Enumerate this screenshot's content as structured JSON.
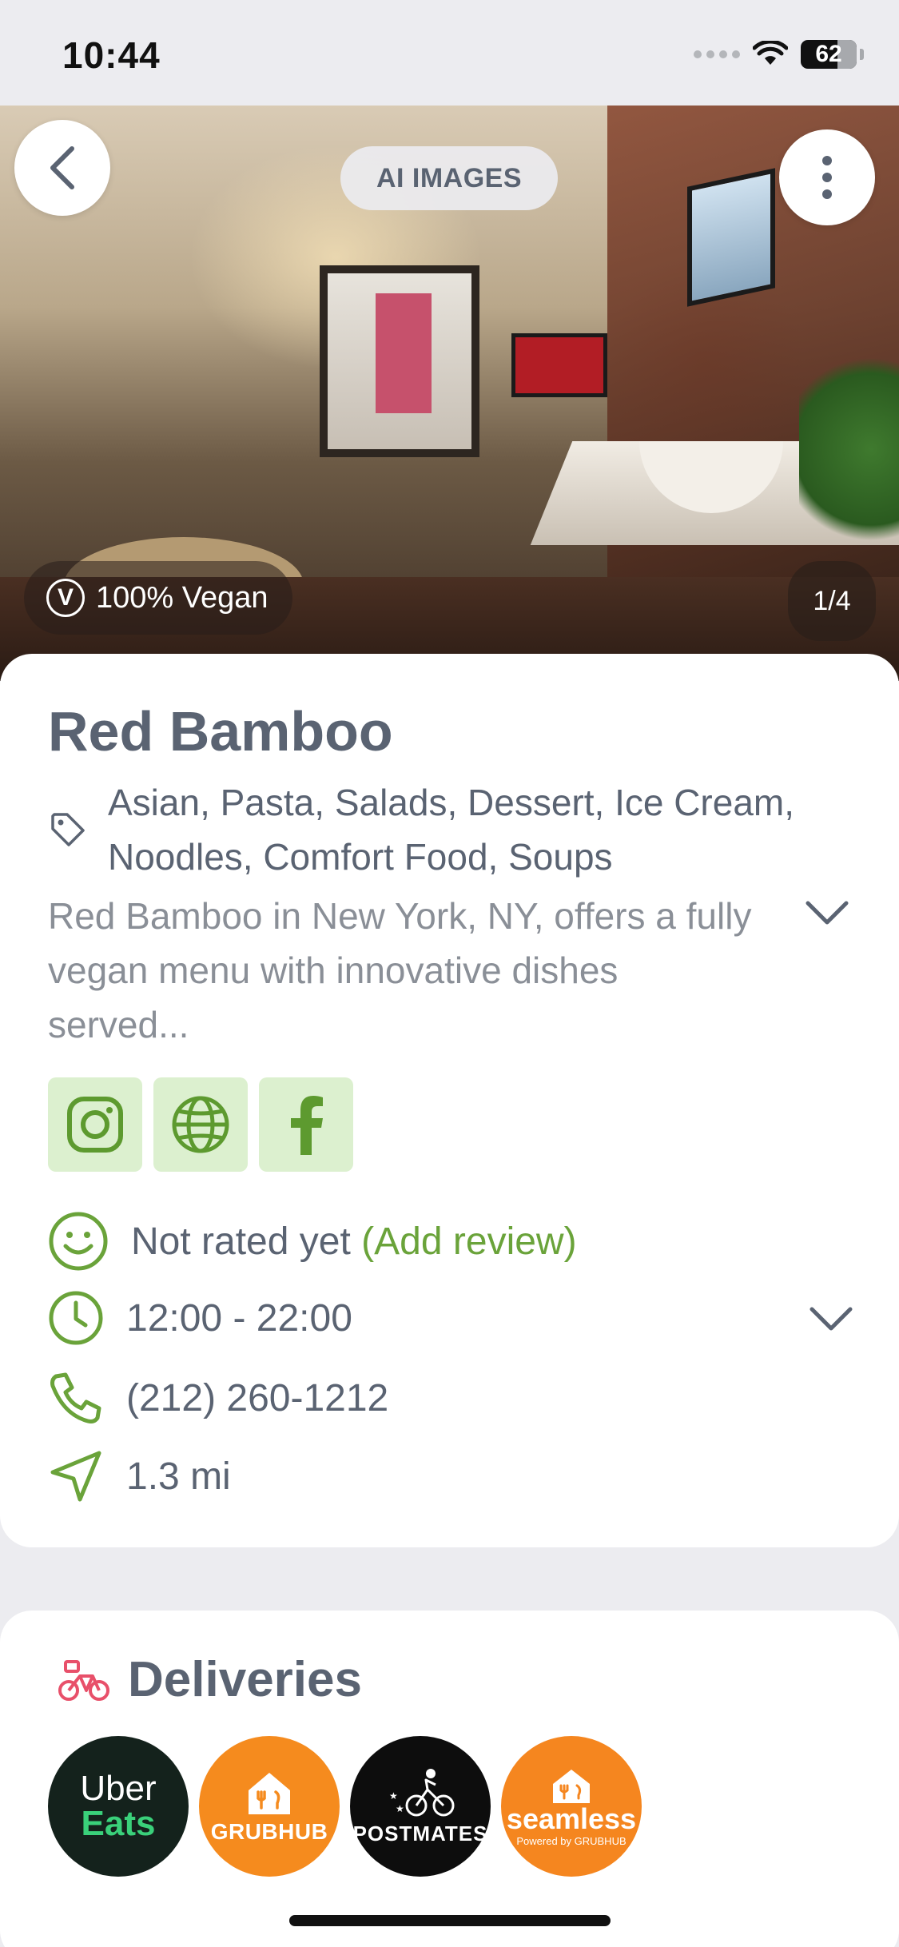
{
  "status_bar": {
    "time": "10:44",
    "battery": "62"
  },
  "hero": {
    "ai_images_label": "AI IMAGES",
    "vegan_badge_letter": "V",
    "vegan_label": "100% Vegan",
    "image_counter": "1/4"
  },
  "restaurant": {
    "name": "Red Bamboo",
    "cuisines": "Asian, Pasta, Salads, Dessert, Ice Cream, Noodles, Comfort Food, Soups",
    "description": "Red Bamboo in New York, NY, offers a fully vegan menu with innovative dishes served..."
  },
  "social": [
    "instagram",
    "website",
    "facebook"
  ],
  "info": {
    "rating_text": "Not rated yet",
    "add_review_label": "(Add review)",
    "hours": "12:00 - 22:00",
    "phone": "(212) 260-1212",
    "distance": "1.3 mi"
  },
  "deliveries": {
    "title": "Deliveries",
    "services": {
      "uber_line1": "Uber",
      "uber_line2": "Eats",
      "grubhub": "GRUBHUB",
      "postmates": "POSTMATES",
      "seamless": "seamless",
      "seamless_sub": "Powered by GRUBHUB"
    }
  },
  "colors": {
    "accent_green": "#6aa33a",
    "icon_bg_green": "#dcf0cf",
    "text_slate": "#5a6372",
    "delivery_pink": "#e8506a",
    "grubhub_orange": "#f58b1e"
  }
}
